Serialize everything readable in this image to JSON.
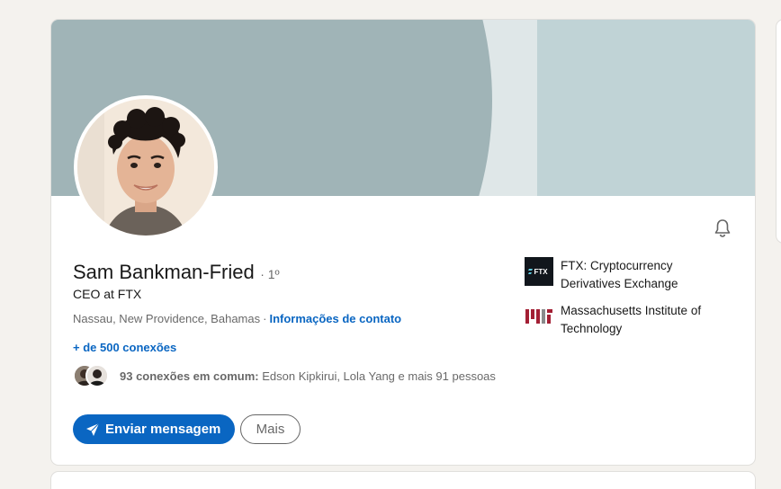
{
  "profile": {
    "name": "Sam Bankman-Fried",
    "degree": "· 1º",
    "headline": "CEO at FTX",
    "location": "Nassau, New Providence, Bahamas",
    "location_separator": "·",
    "contact_info_label": "Informações de contato",
    "connections": "+ de 500 conexões",
    "mutual": {
      "count_label": "93 conexões em comum:",
      "names": " Edson Kipkirui, Lola Yang e mais 91 pessoas"
    }
  },
  "actions": {
    "message_label": "Enviar mensagem",
    "more_label": "Mais"
  },
  "organizations": [
    {
      "name": "FTX: Cryptocurrency Derivatives Exchange",
      "logo_text": "FTX",
      "icon": "ftx-logo"
    },
    {
      "name": "Massachusetts Institute of Technology",
      "icon": "mit-logo"
    }
  ],
  "icons": {
    "notification": "bell-icon",
    "send": "paper-plane-icon"
  },
  "colors": {
    "accent": "#0a66c2",
    "banner_dark": "#a0b4b7",
    "banner_light": "#c0d3d6",
    "mit_red": "#a31f34"
  }
}
